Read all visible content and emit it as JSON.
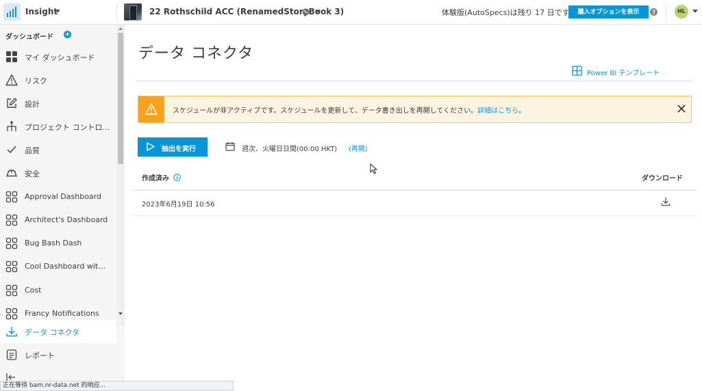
{
  "header": {
    "app_name": "Insight",
    "project_name": "22 Rothschild ACC (RenamedStoryBook 3)",
    "trial_text": "体験版(AutoSpecs)は残り 17 日です",
    "buy_button": "購入オプションを表示",
    "avatar_initials": "HL"
  },
  "sidebar": {
    "heading": "ダッシュボード",
    "items": [
      {
        "label": "マイ ダッシュボード",
        "icon": "grid-4-filled-icon"
      },
      {
        "label": "リスク",
        "icon": "warning-triangle-icon"
      },
      {
        "label": "設計",
        "icon": "edit-square-icon"
      },
      {
        "label": "プロジェクト コントロ...",
        "icon": "hierarchy-icon"
      },
      {
        "label": "品質",
        "icon": "checkmark-icon"
      },
      {
        "label": "安全",
        "icon": "hard-hat-icon"
      },
      {
        "label": "Approval Dashboard",
        "icon": "grid-4-outline-icon"
      },
      {
        "label": "Architect's Dashboard",
        "icon": "grid-4-outline-icon"
      },
      {
        "label": "Bug Bash Dash",
        "icon": "grid-4-outline-icon"
      },
      {
        "label": "Cool Dashboard with a...",
        "icon": "grid-4-outline-icon"
      },
      {
        "label": "Cost",
        "icon": "grid-4-outline-icon"
      },
      {
        "label": "Francy Notifications",
        "icon": "grid-4-outline-icon"
      },
      {
        "label": "データ コネクタ",
        "icon": "download-icon"
      },
      {
        "label": "レポート",
        "icon": "report-icon"
      }
    ],
    "active_index": 12
  },
  "status_bar": "正在等待 bam.nr-data.net 的响应...",
  "main": {
    "title": "データ コネクタ",
    "powerbi_link": "Power BI テンプレート",
    "banner": {
      "text": "スケジュールが非アクティブです。スケジュールを更新して、データ書き出しを再開してください。",
      "link": "詳細はこちら",
      "suffix": "。"
    },
    "run_button": "抽出を実行",
    "schedule_text": "週次、火曜日日間(00:00 HKT)",
    "schedule_link": "(再開)",
    "table": {
      "col_created": "作成済み",
      "col_download": "ダウンロード",
      "rows": [
        {
          "created": "2023年6月19日 10:56"
        }
      ]
    }
  },
  "colors": {
    "accent": "#0696d7",
    "warning": "#faa21b",
    "warning_bg": "#fdf3e1",
    "sidebar_bg": "#f5f5f5"
  }
}
